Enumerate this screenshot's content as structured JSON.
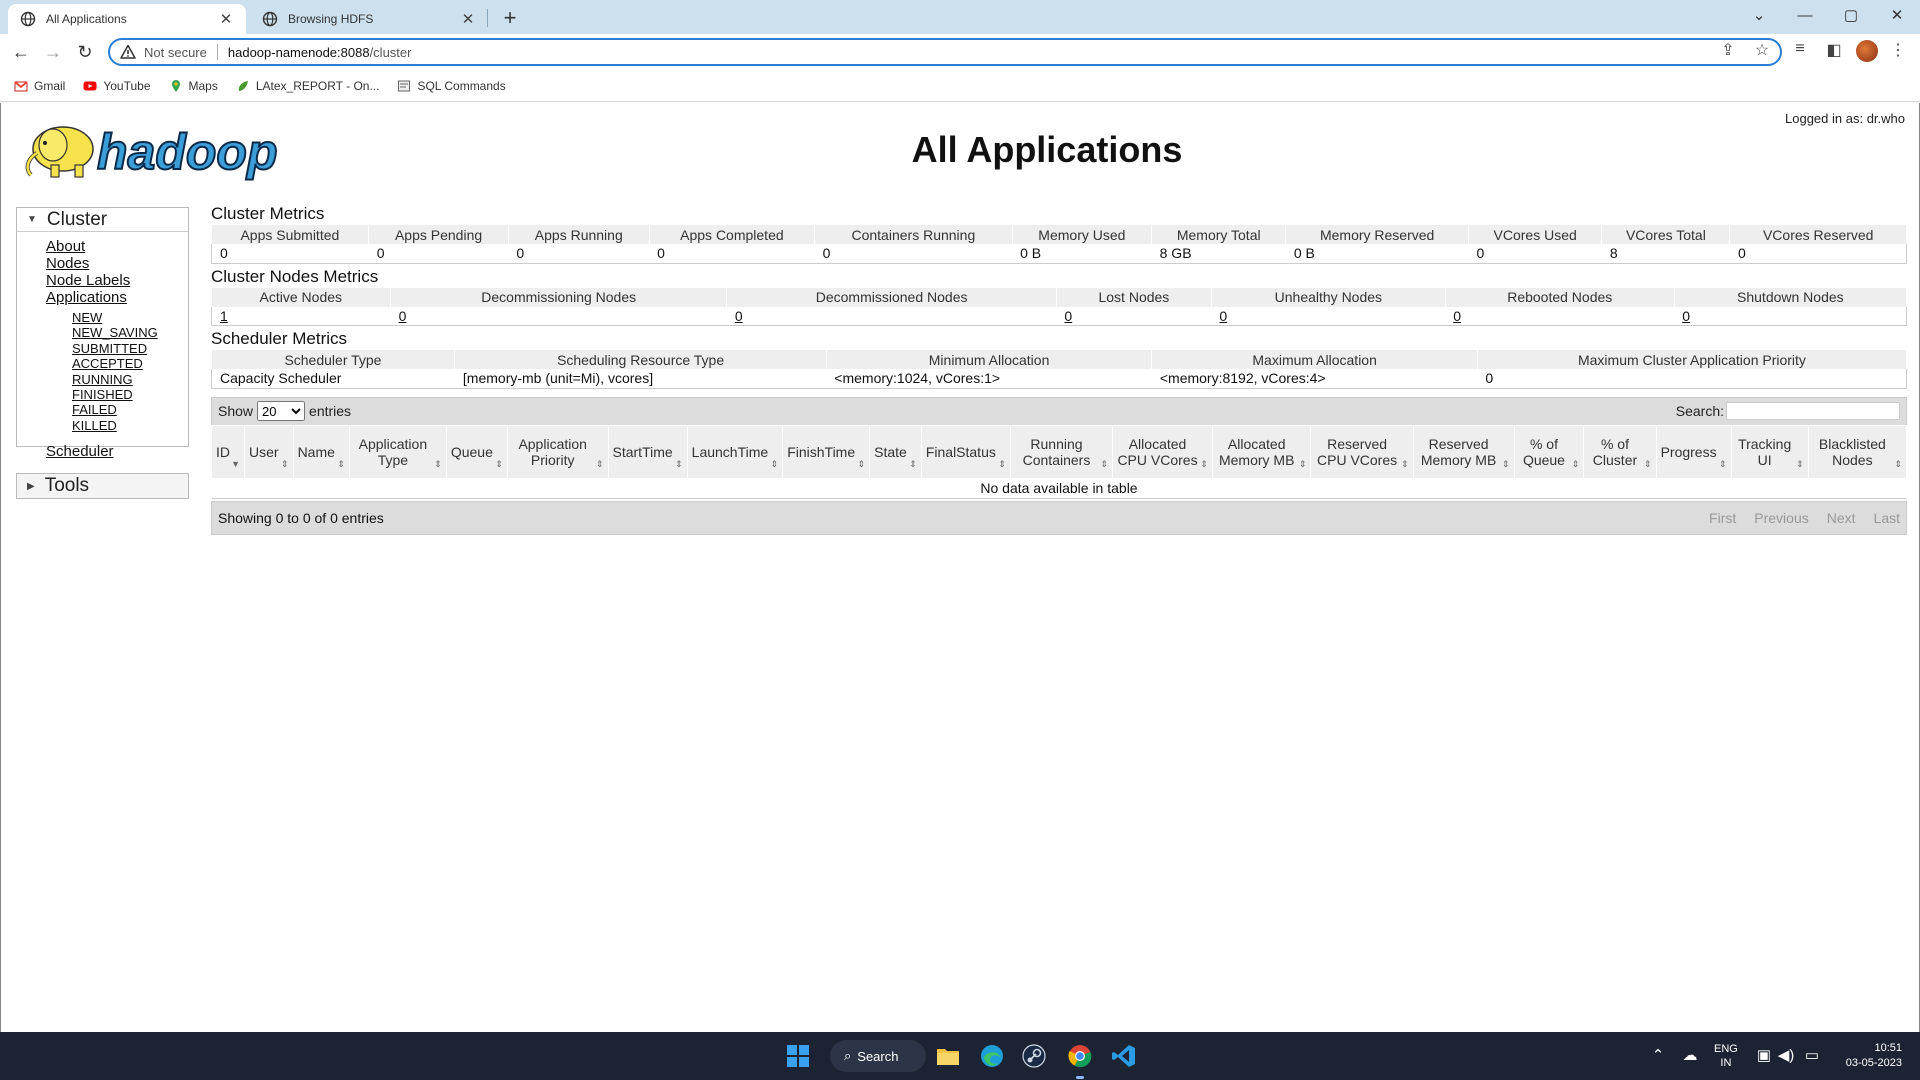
{
  "browser": {
    "tabs": [
      {
        "title": "All Applications"
      },
      {
        "title": "Browsing HDFS"
      }
    ],
    "new_tab": "+",
    "window_controls": {
      "minimize": "—",
      "maximize": "▢",
      "close": "✕"
    },
    "address": {
      "security_label": "Not secure",
      "host": "hadoop-namenode:8088",
      "path": "/cluster"
    },
    "bookmarks": [
      {
        "label": "Gmail",
        "icon": "gmail-icon"
      },
      {
        "label": "YouTube",
        "icon": "youtube-icon"
      },
      {
        "label": "Maps",
        "icon": "maps-icon"
      },
      {
        "label": "LAtex_REPORT - On...",
        "icon": "overleaf-icon"
      },
      {
        "label": "SQL Commands",
        "icon": "page-icon"
      }
    ]
  },
  "page": {
    "title": "All Applications",
    "logged_in": "Logged in as: dr.who",
    "logo_text": "hadoop"
  },
  "sidebar": {
    "cluster_heading": "Cluster",
    "links": [
      "About",
      "Nodes",
      "Node Labels",
      "Applications"
    ],
    "app_states": [
      "NEW",
      "NEW_SAVING",
      "SUBMITTED",
      "ACCEPTED",
      "RUNNING",
      "FINISHED",
      "FAILED",
      "KILLED"
    ],
    "scheduler": "Scheduler",
    "tools_heading": "Tools"
  },
  "cluster_metrics": {
    "title": "Cluster Metrics",
    "headers": [
      "Apps Submitted",
      "Apps Pending",
      "Apps Running",
      "Apps Completed",
      "Containers Running",
      "Memory Used",
      "Memory Total",
      "Memory Reserved",
      "VCores Used",
      "VCores Total",
      "VCores Reserved"
    ],
    "values": [
      "0",
      "0",
      "0",
      "0",
      "0",
      "0 B",
      "8 GB",
      "0 B",
      "0",
      "8",
      "0"
    ]
  },
  "node_metrics": {
    "title": "Cluster Nodes Metrics",
    "headers": [
      "Active Nodes",
      "Decommissioning Nodes",
      "Decommissioned Nodes",
      "Lost Nodes",
      "Unhealthy Nodes",
      "Rebooted Nodes",
      "Shutdown Nodes"
    ],
    "values": [
      "1",
      "0",
      "0",
      "0",
      "0",
      "0",
      "0"
    ]
  },
  "scheduler_metrics": {
    "title": "Scheduler Metrics",
    "headers": [
      "Scheduler Type",
      "Scheduling Resource Type",
      "Minimum Allocation",
      "Maximum Allocation",
      "Maximum Cluster Application Priority"
    ],
    "values": [
      "Capacity Scheduler",
      "[memory-mb (unit=Mi), vcores]",
      "<memory:1024, vCores:1>",
      "<memory:8192, vCores:4>",
      "0"
    ]
  },
  "apps_table": {
    "show_label": "Show",
    "entries_label": "entries",
    "page_size": "20",
    "search_label": "Search:",
    "columns": [
      "ID",
      "User",
      "Name",
      "Application Type",
      "Queue",
      "Application Priority",
      "StartTime",
      "LaunchTime",
      "FinishTime",
      "State",
      "FinalStatus",
      "Running Containers",
      "Allocated CPU VCores",
      "Allocated Memory MB",
      "Reserved CPU VCores",
      "Reserved Memory MB",
      "% of Queue",
      "% of Cluster",
      "Progress",
      "Tracking UI",
      "Blacklisted Nodes"
    ],
    "empty_message": "No data available in table",
    "info": "Showing 0 to 0 of 0 entries",
    "pagination": [
      "First",
      "Previous",
      "Next",
      "Last"
    ]
  },
  "taskbar": {
    "search_label": "Search",
    "lang_line1": "ENG",
    "lang_line2": "IN",
    "time": "10:51",
    "date": "03-05-2023"
  }
}
